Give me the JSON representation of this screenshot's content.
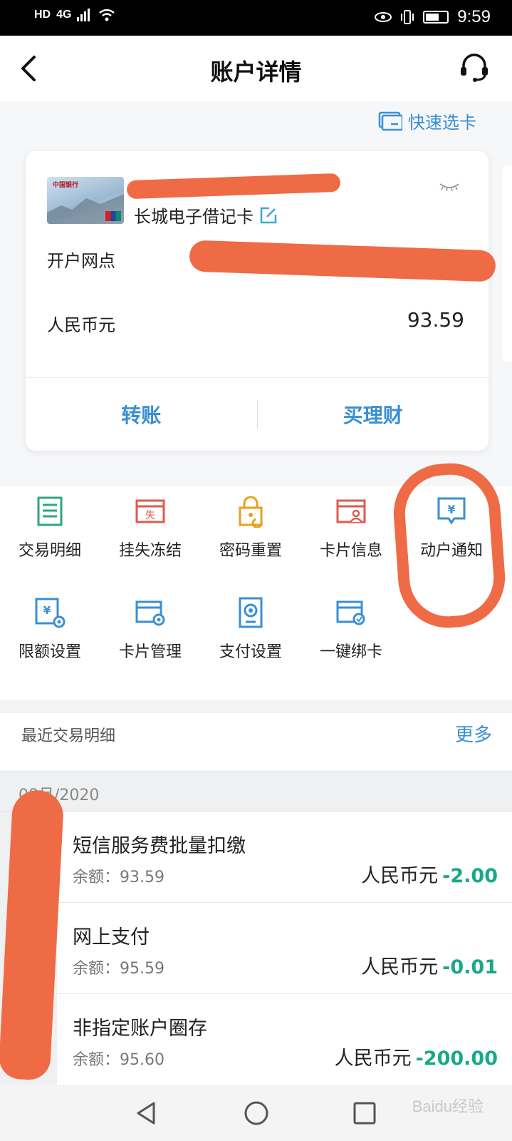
{
  "status": {
    "network": "HD",
    "signal": "4G",
    "time": "9:59"
  },
  "header": {
    "title": "账户详情"
  },
  "quick_select": "快速选卡",
  "card": {
    "name": "长城电子借记卡",
    "branch_label": "开户网点",
    "currency_label": "人民币元",
    "balance": "93.59",
    "bank_logo_text": "中国银行"
  },
  "card_actions": {
    "transfer": "转账",
    "wealth": "买理财"
  },
  "functions": [
    {
      "label": "交易明细",
      "icon": "ledger-icon",
      "color": "#2ea77d"
    },
    {
      "label": "挂失冻结",
      "icon": "report-loss-icon",
      "color": "#e05a50"
    },
    {
      "label": "密码重置",
      "icon": "lock-reset-icon",
      "color": "#e6a21d"
    },
    {
      "label": "卡片信息",
      "icon": "card-info-icon",
      "color": "#e05a50"
    },
    {
      "label": "动户通知",
      "icon": "yuan-notify-icon",
      "color": "#3a8fd4"
    },
    {
      "label": "限额设置",
      "icon": "limit-settings-icon",
      "color": "#3a8fd4"
    },
    {
      "label": "卡片管理",
      "icon": "card-manage-icon",
      "color": "#3a8fd4"
    },
    {
      "label": "支付设置",
      "icon": "payment-settings-icon",
      "color": "#3a8fd4"
    },
    {
      "label": "一键绑卡",
      "icon": "bind-card-icon",
      "color": "#3a8fd4"
    }
  ],
  "recent": {
    "title": "最近交易明细",
    "more": "更多",
    "month": "08月/2020"
  },
  "transactions": [
    {
      "name": "短信服务费批量扣缴",
      "balance": "余额：93.59",
      "currency": "人民币元",
      "amount": "-2.00"
    },
    {
      "name": "网上支付",
      "balance": "余额：95.59",
      "currency": "人民币元",
      "amount": "-0.01"
    },
    {
      "name": "非指定账户圈存",
      "balance": "余额：95.60",
      "currency": "人民币元",
      "amount": "-200.00"
    }
  ],
  "watermark": "Baidu经验",
  "colors": {
    "accent": "#3a8fd4",
    "negative_amount": "#1aa88a",
    "annotation": "#ef6b45"
  }
}
